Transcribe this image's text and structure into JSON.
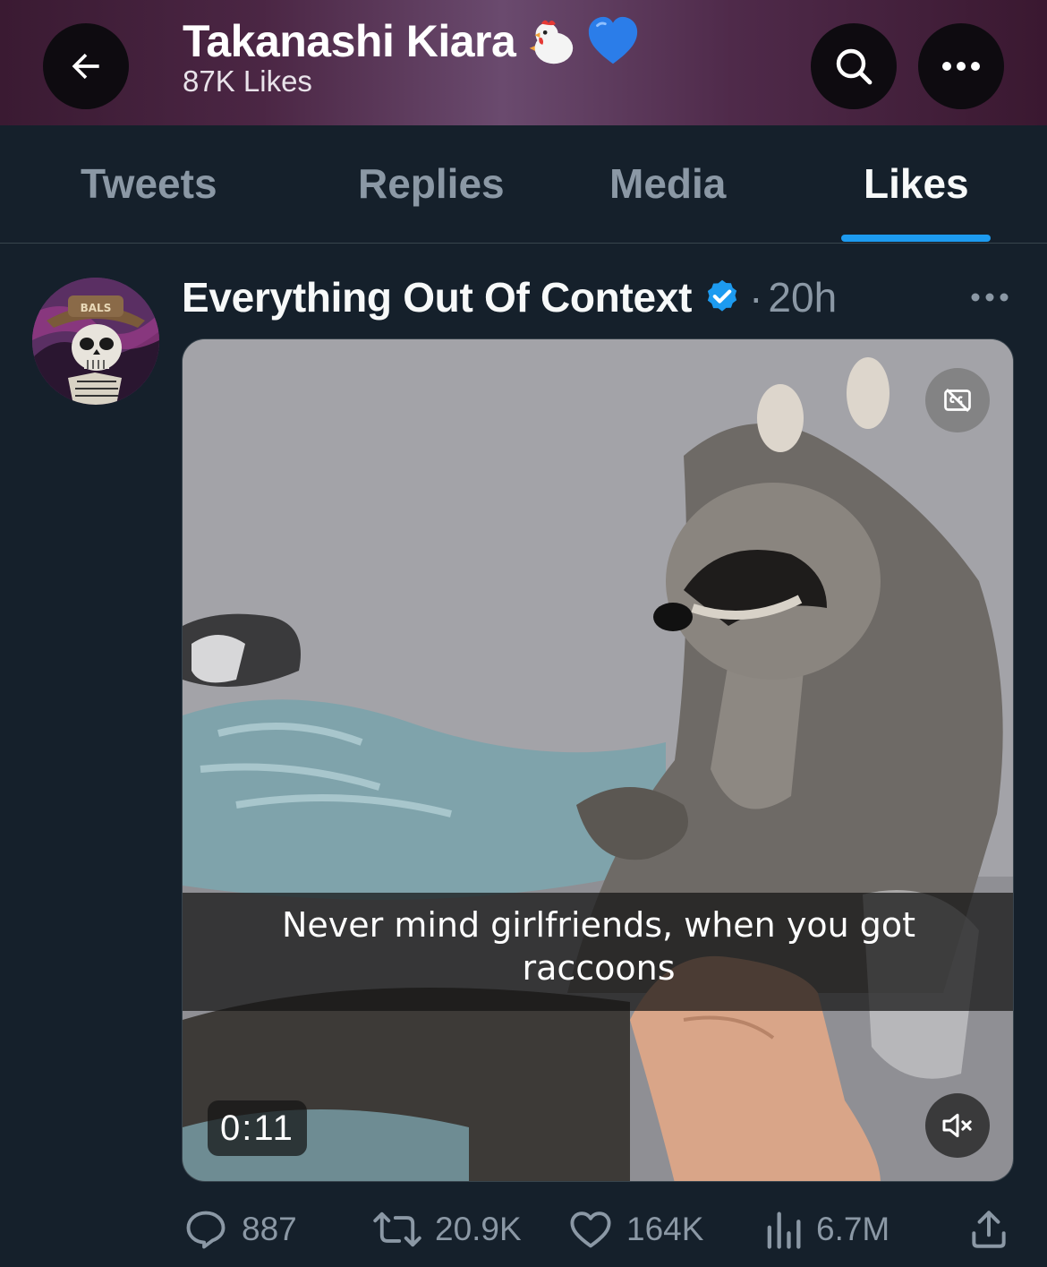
{
  "header": {
    "name": "Takanashi Kiara",
    "name_emoji": "chicken-emoji",
    "heart_emoji": "blue-heart-emoji",
    "likes_count": "87K Likes"
  },
  "tabs": [
    {
      "label": "Tweets",
      "active": false
    },
    {
      "label": "Replies",
      "active": false
    },
    {
      "label": "Media",
      "active": false
    },
    {
      "label": "Likes",
      "active": true
    }
  ],
  "tweet": {
    "author": "Everything Out Of Context",
    "separator": "·",
    "time": "20h",
    "verified": true,
    "media": {
      "caption": "Never mind girlfriends, when you got raccoons",
      "duration": "0:11",
      "muted": true
    },
    "actions": {
      "replies": "887",
      "retweets": "20.9K",
      "likes": "164K",
      "views": "6.7M"
    }
  },
  "colors": {
    "background": "#15202b",
    "accent": "#1d9bf0",
    "muted_text": "#8b98a5"
  }
}
